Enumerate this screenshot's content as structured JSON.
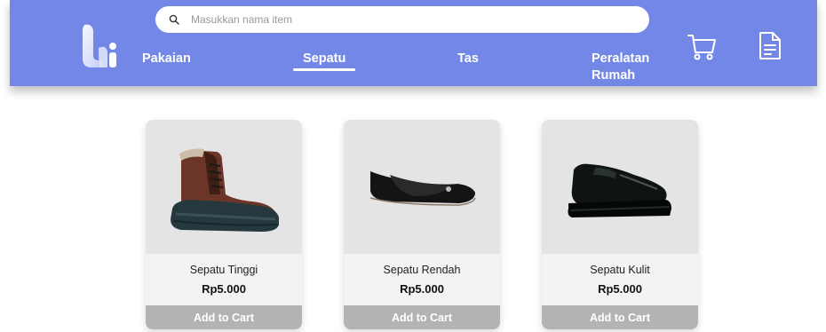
{
  "search": {
    "placeholder": "Masukkan nama item"
  },
  "nav": {
    "items": [
      {
        "label": "Pakaian"
      },
      {
        "label": "Sepatu",
        "active": true
      },
      {
        "label": "Tas"
      },
      {
        "label": "Peralatan Rumah"
      }
    ]
  },
  "icons": {
    "logo": "brand-logo",
    "search": "search-icon",
    "cart": "cart-icon",
    "document": "document-icon"
  },
  "colors": {
    "header": "#7388e6",
    "card_image_bg": "#e4e4e4",
    "card_body_bg": "#f4f2f2",
    "button_bg": "#b3b3b3"
  },
  "products": [
    {
      "name": "Sepatu Tinggi",
      "price": "Rp5.000",
      "button": "Add to Cart"
    },
    {
      "name": "Sepatu Rendah",
      "price": "Rp5.000",
      "button": "Add to Cart"
    },
    {
      "name": "Sepatu Kulit",
      "price": "Rp5.000",
      "button": "Add to Cart"
    }
  ]
}
